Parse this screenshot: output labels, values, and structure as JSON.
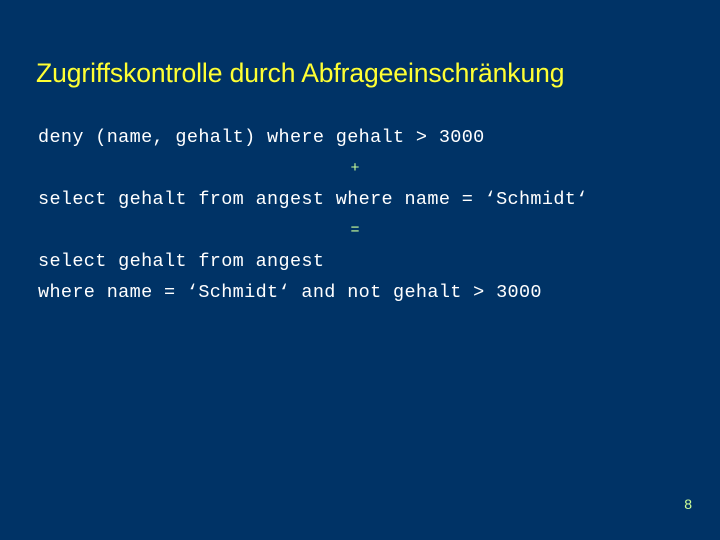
{
  "slide": {
    "background_color": "#003366",
    "title": "Zugriffskontrolle durch Abfrageeinschränkung",
    "title_color": "#ffff33",
    "body_text_color": "#ffffff",
    "operator_color": "#ccff99",
    "page_number": "8",
    "lines": [
      {
        "text": "deny (name, gehalt) where gehalt > 3000",
        "style": "code"
      },
      {
        "text": "+",
        "style": "operator"
      },
      {
        "text": "select gehalt from angest where name = ‘Schmidt‘",
        "style": "code"
      },
      {
        "text": "=",
        "style": "operator"
      },
      {
        "text": "select gehalt from angest",
        "style": "code"
      },
      {
        "text": "where name = ‘Schmidt‘ and not gehalt > 3000",
        "style": "code"
      }
    ]
  }
}
